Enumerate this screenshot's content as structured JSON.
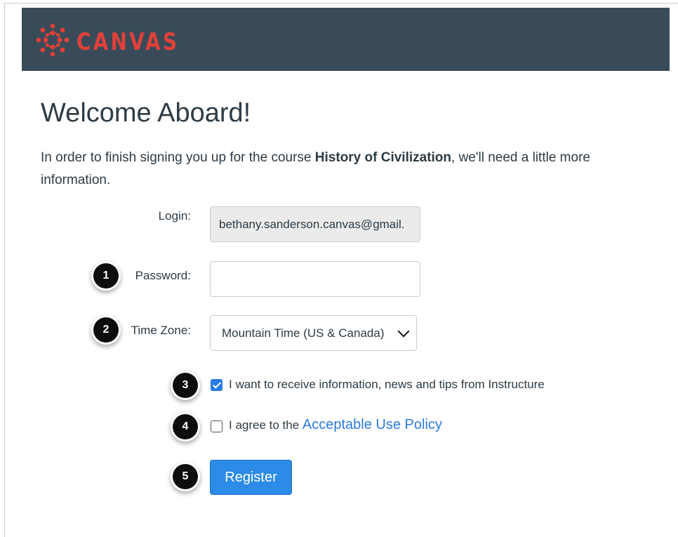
{
  "brand": {
    "name": "CANVAS",
    "logo_icon": "canvas-ring-icon",
    "color": "#e0413a",
    "header_bg": "#394b58"
  },
  "page": {
    "title": "Welcome Aboard!",
    "intro_before": "In order to finish signing you up for the course ",
    "course_name": "History of Civilization",
    "intro_after": ", we'll need a little more information."
  },
  "form": {
    "login_label": "Login:",
    "login_value": "bethany.sanderson.canvas@gmail.",
    "password_label": "Password:",
    "password_value": "",
    "timezone_label": "Time Zone:",
    "timezone_value": "Mountain Time (US & Canada)",
    "receive_info_label": "I want to receive information, news and tips from Instructure",
    "receive_info_checked": true,
    "agree_prefix": "I agree to the ",
    "policy_link": "Acceptable Use Policy",
    "agree_checked": false,
    "register_label": "Register"
  },
  "callouts": [
    "1",
    "2",
    "3",
    "4",
    "5"
  ],
  "colors": {
    "accent": "#2b7ae2",
    "button": "#2b8be6",
    "text": "#2d3b45"
  }
}
